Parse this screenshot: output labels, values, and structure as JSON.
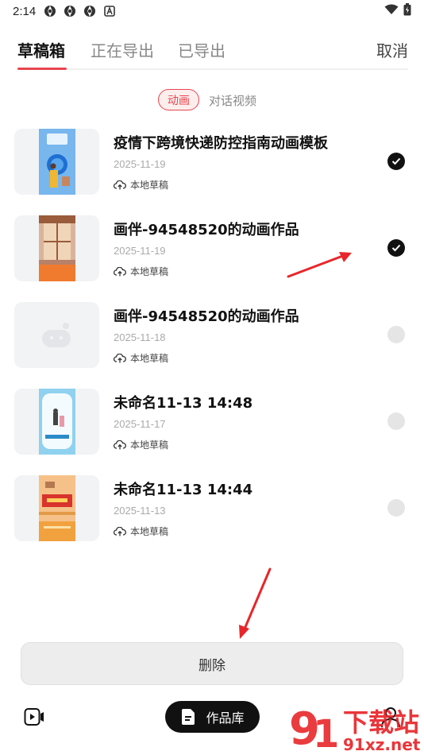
{
  "status": {
    "time": "2:14",
    "left_icons": [
      "browser-icon",
      "browser-icon",
      "browser-icon",
      "a-icon"
    ],
    "right_icons": [
      "wifi-icon",
      "battery-icon"
    ]
  },
  "tabs": [
    {
      "label": "草稿箱",
      "active": true
    },
    {
      "label": "正在导出",
      "active": false
    },
    {
      "label": "已导出",
      "active": false
    }
  ],
  "cancel_label": "取消",
  "filters": {
    "active": "动画",
    "inactive": "对话视频"
  },
  "drafts": [
    {
      "title": "疫情下跨境快递防控指南动画模板",
      "date": "2025-11-19",
      "source": "本地草稿",
      "selected": true,
      "thumb": "blue-poster"
    },
    {
      "title": "画伴-94548520的动画作品",
      "date": "2025-11-19",
      "source": "本地草稿",
      "selected": true,
      "thumb": "window-room"
    },
    {
      "title": "画伴-94548520的动画作品",
      "date": "2025-11-18",
      "source": "本地草稿",
      "selected": false,
      "thumb": "placeholder"
    },
    {
      "title": "未命名11-13 14:48",
      "date": "2025-11-17",
      "source": "本地草稿",
      "selected": false,
      "thumb": "cloud-frame"
    },
    {
      "title": "未命名11-13 14:44",
      "date": "2025-11-13",
      "source": "本地草稿",
      "selected": false,
      "thumb": "orange-stage"
    }
  ],
  "delete_label": "删除",
  "bottom_nav": {
    "pill_label": "作品库"
  },
  "watermark": {
    "site": "91xz.net",
    "text": "下载站"
  },
  "colors": {
    "accent": "#e8454f",
    "annotation_arrow": "#e8262a"
  }
}
